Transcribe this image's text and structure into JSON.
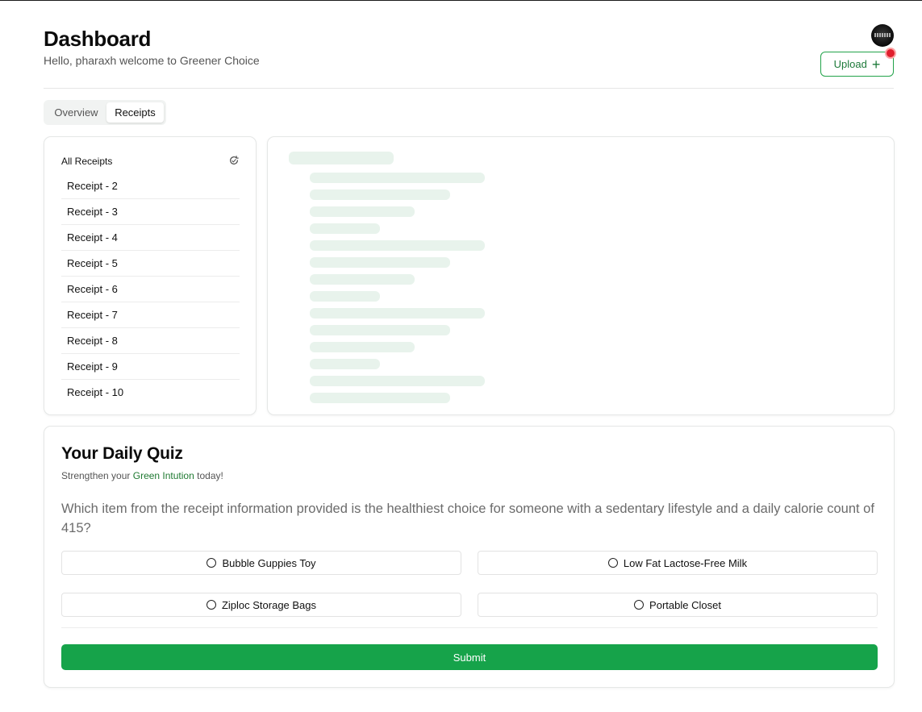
{
  "header": {
    "title": "Dashboard",
    "greeting": "Hello, pharaxh welcome to Greener Choice",
    "upload_label": "Upload"
  },
  "tabs": [
    {
      "label": "Overview",
      "active": false
    },
    {
      "label": "Receipts",
      "active": true
    }
  ],
  "receipts": {
    "heading": "All Receipts",
    "items": [
      "Receipt - 2",
      "Receipt - 3",
      "Receipt - 4",
      "Receipt - 5",
      "Receipt - 6",
      "Receipt - 7",
      "Receipt - 8",
      "Receipt - 9",
      "Receipt - 10"
    ]
  },
  "quiz": {
    "title": "Your Daily Quiz",
    "subtitle_pre": "Strengthen your ",
    "subtitle_highlight": "Green Intution",
    "subtitle_post": " today!",
    "question": "Which item from the receipt information provided is the healthiest choice for someone with a sedentary lifestyle and a daily calorie count of 415?",
    "options": [
      "Bubble Guppies Toy",
      "Low Fat Lactose-Free Milk",
      "Ziploc Storage Bags",
      "Portable Closet"
    ],
    "submit_label": "Submit"
  },
  "colors": {
    "accent": "#16a34a",
    "skeleton": "#e8f3ec",
    "notification": "#e01f2d"
  }
}
